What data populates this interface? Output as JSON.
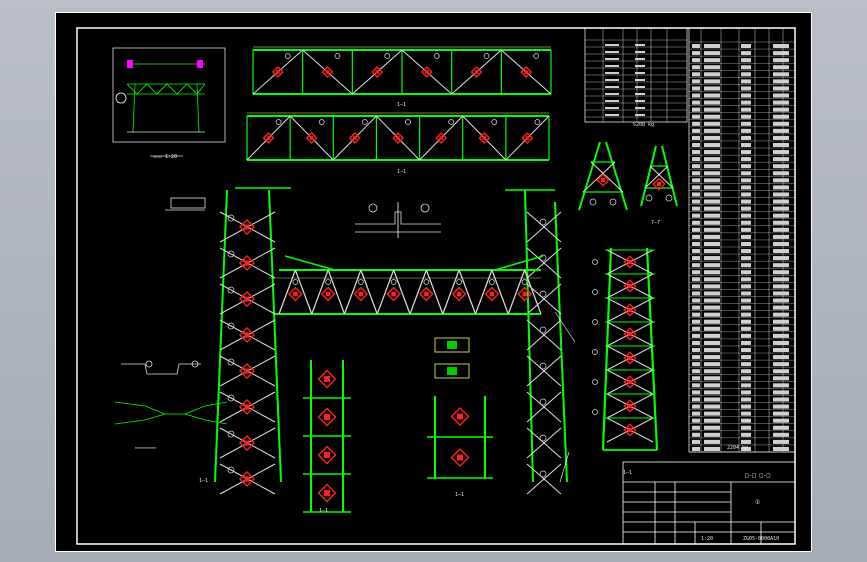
{
  "drawing": {
    "section_labels": [
      "1—1",
      "1—1",
      "7—7",
      "1—1",
      "1—1",
      "1—1",
      "1—1"
    ],
    "parts_table": {
      "rows": 58,
      "footer": "2204 kg"
    },
    "material_table": {
      "total": "5208 kg"
    },
    "title_block": {
      "title": "□-□  □-□",
      "drawing_no": "ZG05-0000A10",
      "scale": "1:20",
      "sheet_mark": "①"
    }
  },
  "colors": {
    "background": "#000000",
    "frame": "#ffffff",
    "member": "#00ff00",
    "bracing": "#e0e0e0",
    "dimension": "#ffff66",
    "plate": "#ff2020",
    "accent": "#ff00ff"
  }
}
